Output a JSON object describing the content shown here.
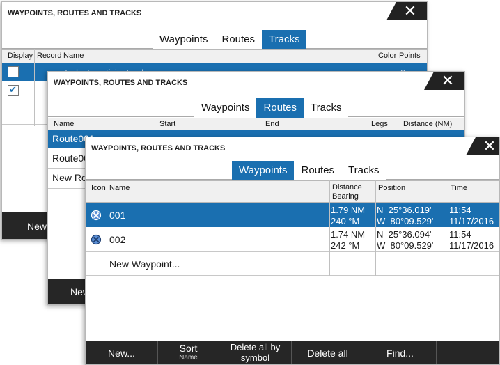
{
  "dialogs": {
    "tracks": {
      "title": "WAYPOINTS, ROUTES AND TRACKS",
      "close": "✕",
      "tabs": [
        "Waypoints",
        "Routes",
        "Tracks"
      ],
      "active_tab": "Tracks",
      "columns": [
        "Display",
        "Record",
        "Name",
        "Color",
        "Points"
      ],
      "row1": {
        "name": "Today's activity track",
        "points": "2"
      },
      "new_label": "New..."
    },
    "routes": {
      "title": "WAYPOINTS, ROUTES AND TRACKS",
      "close": "✕",
      "tabs": [
        "Waypoints",
        "Routes",
        "Tracks"
      ],
      "active_tab": "Routes",
      "columns": [
        "Name",
        "Start",
        "End",
        "Legs",
        "Distance (NM)"
      ],
      "rows": [
        "Route001",
        "Route002",
        "New Route..."
      ],
      "new_label": "New..."
    },
    "waypoints": {
      "title": "WAYPOINTS, ROUTES AND TRACKS",
      "close": "✕",
      "tabs": [
        "Waypoints",
        "Routes",
        "Tracks"
      ],
      "active_tab": "Waypoints",
      "columns": {
        "icon": "Icon",
        "name": "Name",
        "distance": "Distance",
        "bearing": "Bearing",
        "position": "Position",
        "time": "Time"
      },
      "rows": [
        {
          "name": "001",
          "distance": "1.79 NM",
          "bearing": "240 °M",
          "lat": "N  25°36.019'",
          "lon": "W  80°09.529'",
          "time": "11:54",
          "date": "11/17/2016",
          "icon": "waypoint-cross-icon"
        },
        {
          "name": "002",
          "distance": "1.74 NM",
          "bearing": "242 °M",
          "lat": "N  25°36.094'",
          "lon": "W  80°09.529'",
          "time": "11:54",
          "date": "11/17/2016",
          "icon": "waypoint-cross-icon"
        }
      ],
      "new_waypoint": "New Waypoint...",
      "buttons": [
        {
          "main": "New...",
          "sub": ""
        },
        {
          "main": "Sort",
          "sub": "Name"
        },
        {
          "main": "Delete all by symbol",
          "sub": ""
        },
        {
          "main": "Delete all",
          "sub": ""
        },
        {
          "main": "Find...",
          "sub": ""
        }
      ]
    }
  },
  "colors": {
    "accent": "#1a6fb0",
    "bar": "#262626",
    "header": "#f0f0f0"
  }
}
